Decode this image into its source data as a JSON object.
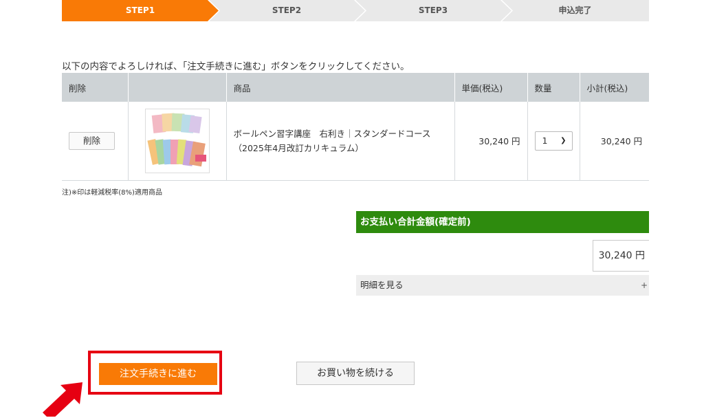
{
  "steps": [
    {
      "label": "STEP1",
      "active": true
    },
    {
      "label": "STEP2",
      "active": false
    },
    {
      "label": "STEP3",
      "active": false
    },
    {
      "label": "申込完了",
      "active": false
    }
  ],
  "instruction": "以下の内容でよろしければ、「注文手続きに進む」ボタンをクリックしてください。",
  "table": {
    "headers": [
      "削除",
      "",
      "商品",
      "単価(税込)",
      "数量",
      "小計(税込)"
    ],
    "rows": [
      {
        "delete_label": "削除",
        "product_name": "ボールペン習字講座　右利き｜スタンダードコース （2025年4月改訂カリキュラム）",
        "unit_price": "30,240 円",
        "quantity": "1",
        "subtotal": "30,240 円"
      }
    ]
  },
  "note": "注)※印は軽減税率(8%)適用商品",
  "total": {
    "header": "お支払い合計金額(確定前)",
    "amount": "30,240 円",
    "detail_label": "明細を見る",
    "detail_toggle": "+"
  },
  "buttons": {
    "order": "注文手続きに進む",
    "continue": "お買い物を続ける"
  },
  "colors": {
    "step_active": "#f97a06",
    "step_inactive": "#e9e9e9",
    "total_header": "#2e8b0e",
    "order_button": "#f97a06",
    "highlight": "#e60012"
  }
}
